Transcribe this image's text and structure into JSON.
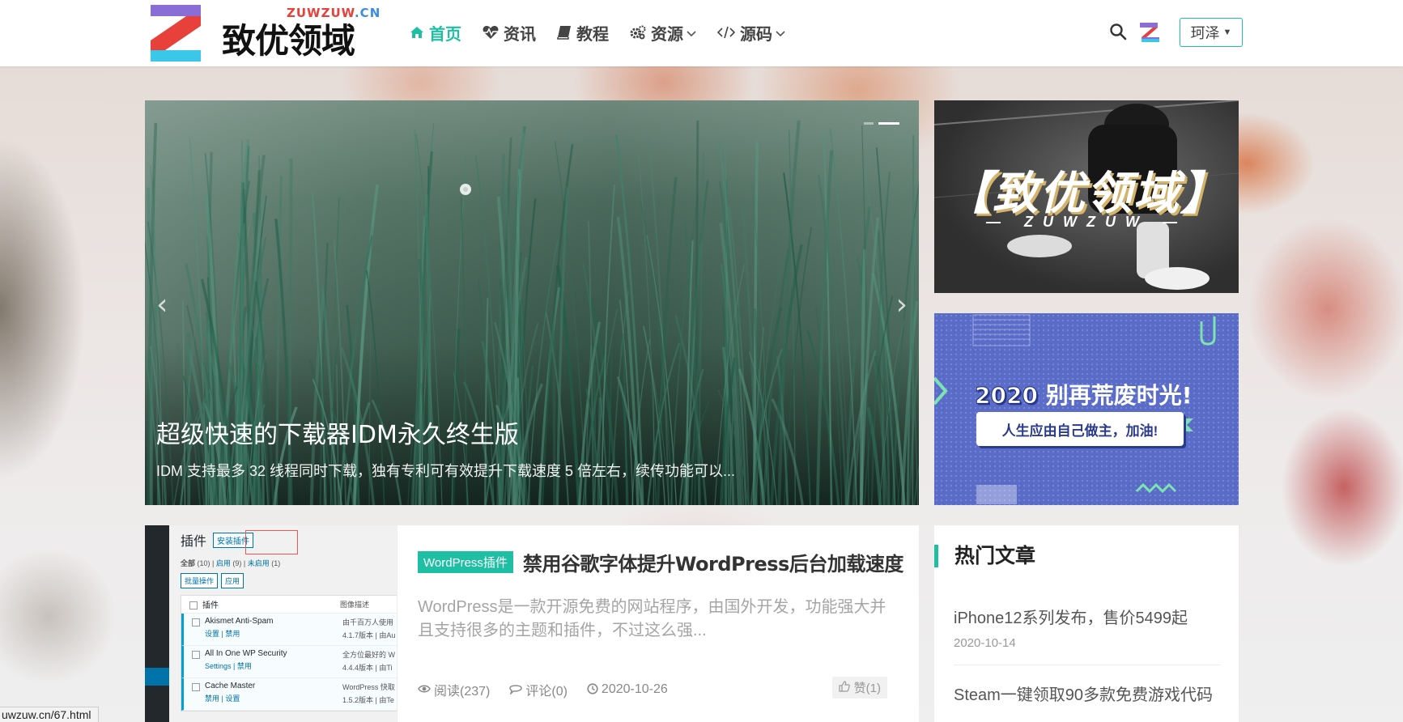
{
  "logo": {
    "sub_r": "ZUWZUW",
    "sub_b": ".CN",
    "name": "致优领域"
  },
  "nav": [
    {
      "label": "首页",
      "icon": "home-icon",
      "active": true,
      "dropdown": false
    },
    {
      "label": "资讯",
      "icon": "heartbeat-icon",
      "active": false,
      "dropdown": false
    },
    {
      "label": "教程",
      "icon": "book-icon",
      "active": false,
      "dropdown": false
    },
    {
      "label": "资源",
      "icon": "gears-icon",
      "active": false,
      "dropdown": true
    },
    {
      "label": "源码",
      "icon": "code-icon",
      "active": false,
      "dropdown": true
    }
  ],
  "user": {
    "name": "珂泽"
  },
  "slider": {
    "title": "超级快速的下载器IDM永久终生版",
    "desc": "IDM 支持最多 32 线程同时下载，独有专利可有效提升下载速度 5 倍左右，续传功能可以...",
    "dots": 2,
    "active_dot": 2
  },
  "ad1": {
    "title": "【致优领域】",
    "sub": "— ZUWZUW —"
  },
  "ad2": {
    "year": "2020",
    "title": "别再荒废时光!",
    "box": "人生应由自己做主，加油!"
  },
  "article": {
    "thumb": {
      "heading": "插件",
      "install": "安装插件",
      "filter_all": "全部",
      "filter_all_count": "(10)",
      "filter_active": "启用",
      "filter_active_count": "(9)",
      "filter_inactive": "未启用",
      "filter_inactive_count": "(1)",
      "bulk": "批量操作",
      "apply": "应用",
      "col_plugin": "插件",
      "col_desc": "图像描述",
      "rows": [
        {
          "name": "Akismet Anti-Spam",
          "links": "设置 | 禁用",
          "desc": "由千百万人使用",
          "ver": "4.1.7版本 | 由Au"
        },
        {
          "name": "All In One WP Security",
          "links": "Settings | 禁用",
          "desc": "全方位最好的 W",
          "ver": "4.4.4版本 | 由Ti"
        },
        {
          "name": "Cache Master",
          "links": "禁用 | 设置",
          "desc": "WordPress 快取",
          "ver": "1.5.2版本 | 由Te"
        }
      ]
    },
    "tag": "WordPress插件",
    "title": "禁用谷歌字体提升WordPress后台加载速度",
    "excerpt": "WordPress是一款开源免费的网站程序，由国外开发，功能强大并且支持很多的主题和插件，不过这么强...",
    "views": "阅读(237)",
    "comments": "评论(0)",
    "date": "2020-10-26",
    "likes": "赞(1)"
  },
  "hot": {
    "title": "热门文章",
    "items": [
      {
        "title": "iPhone12系列发布，售价5499起",
        "date": "2020-10-14"
      },
      {
        "title": "Steam一键领取90多款免费游戏代码",
        "date": ""
      }
    ]
  },
  "statusbar": "uwzuw.cn/67.html"
}
